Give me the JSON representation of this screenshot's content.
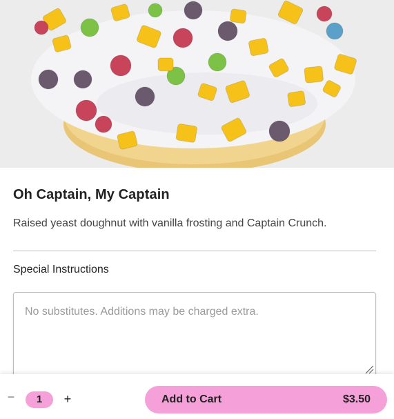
{
  "product": {
    "image_alt": "doughnut-photo",
    "title": "Oh Captain, My Captain",
    "description": "Raised yeast doughnut with vanilla frosting and Captain Crunch."
  },
  "special_instructions": {
    "label": "Special Instructions",
    "placeholder": "No substitutes. Additions may be charged extra.",
    "value": ""
  },
  "footer": {
    "minus_symbol": "−",
    "quantity": "1",
    "plus_symbol": "+",
    "add_to_cart_label": "Add to Cart",
    "price": "$3.50"
  },
  "colors": {
    "accent_pink": "#f5a0d9",
    "frosting": "#f4f4f6",
    "cereal_yellow": "#f6c21a",
    "cereal_green": "#7cc246",
    "cereal_red": "#c8445a",
    "cereal_purple": "#6b5a6e",
    "cereal_blue": "#5aa0c8"
  }
}
